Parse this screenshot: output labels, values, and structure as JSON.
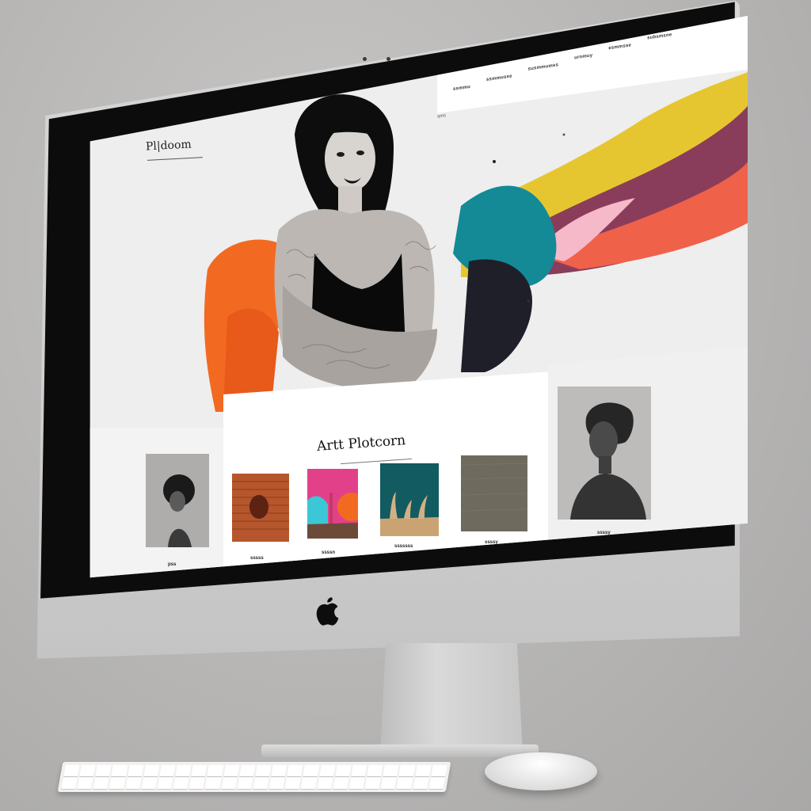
{
  "site": {
    "brand": "Pl|doom",
    "tagline": "sms",
    "nav": [
      "ssmmu",
      "ssmmusse",
      "susmmumss",
      "urnmuy",
      "esmmsse",
      "subsmsne"
    ]
  },
  "hero": {
    "accent_colors": [
      "#f26a21",
      "#138a96",
      "#e6c630",
      "#8a3d5b",
      "#f0614a",
      "#f6b9c9"
    ]
  },
  "gallery": {
    "title": "Artt Plotcorn",
    "items": [
      {
        "caption": "pss",
        "art": "portrait-afro"
      },
      {
        "caption": "sssss",
        "art": "orange-circle"
      },
      {
        "caption": "ssssn",
        "art": "pink-cyan-landscape"
      },
      {
        "caption": "sssssss",
        "art": "teal-grass"
      },
      {
        "caption": "ssssy",
        "art": "gray-texture"
      },
      {
        "caption": "ssssy",
        "art": "portrait-statue"
      }
    ]
  },
  "device": {
    "logo": "apple-logo"
  }
}
